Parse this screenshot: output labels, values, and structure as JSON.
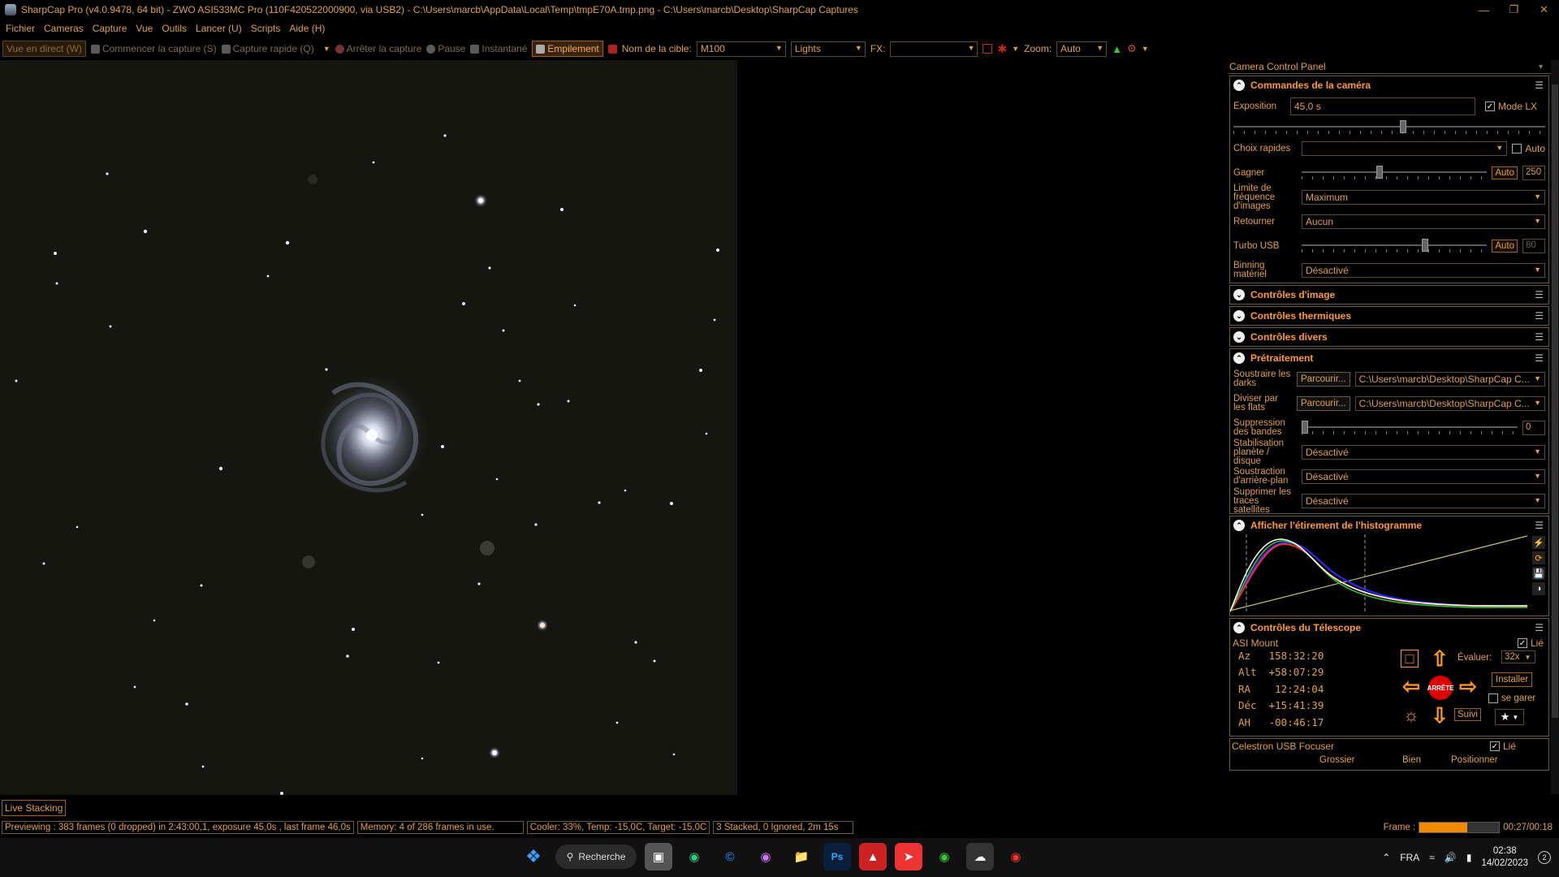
{
  "window": {
    "title": "SharpCap Pro (v4.0.9478, 64 bit) - ZWO ASI533MC Pro (110F420522000900, via USB2) - C:\\Users\\marcb\\AppData\\Local\\Temp\\tmpE70A.tmp.png - C:\\Users\\marcb\\Desktop\\SharpCap Captures"
  },
  "menu": [
    "Fichier",
    "Cameras",
    "Capture",
    "Vue",
    "Outils",
    "Lancer (U)",
    "Scripts",
    "Aide (H)"
  ],
  "toolbar": {
    "live": "Vue en direct (W)",
    "start": "Commencer la capture (S)",
    "quick": "Capture rapide (Q)",
    "stop": "Arrêter la capture",
    "pause": "Pause",
    "snapshot": "Instantané",
    "stack": "Empilement",
    "target_label": "Nom de la cible:",
    "target_value": "M100",
    "frame_type": "Lights",
    "fx_label": "FX:",
    "fx_value": "",
    "zoom_label": "Zoom:",
    "zoom_value": "Auto"
  },
  "viewer": {
    "live_stacking": "Live Stacking"
  },
  "status": {
    "preview": "Previewing : 383 frames (0 dropped) in 2:43:00,1, exposure 45,0s , last frame 46,0s",
    "memory": "Memory: 4 of 286 frames in use.",
    "cooler": "Cooler: 33%, Temp: -15,0C, Target: -15,0C",
    "stacked": "3 Stacked, 0 Ignored, 2m 15s",
    "frame_label": "Frame :",
    "frame_time": "00:27/00:18",
    "frame_progress": 0.6
  },
  "panel": {
    "title": "Camera Control Panel",
    "camera": {
      "header": "Commandes de la caméra",
      "exposure_label": "Exposition",
      "exposure_value": "45,0 s",
      "lx_label": "Mode LX",
      "quick_label": "Choix rapides",
      "auto_label": "Auto",
      "gain_label": "Gagner",
      "gain_auto": "Auto",
      "gain_value": "250",
      "fps_label": "Limite de fréquence d'images",
      "fps_value": "Maximum",
      "flip_label": "Retourner",
      "flip_value": "Aucun",
      "turbo_label": "Turbo USB",
      "turbo_auto": "Auto",
      "turbo_value": "80",
      "binning_label": "Binning matériel",
      "binning_value": "Désactivé"
    },
    "collapsed": [
      "Contrôles d'image",
      "Contrôles thermiques",
      "Contrôles divers"
    ],
    "preproc": {
      "header": "Prétraitement",
      "darks_label": "Soustraire les darks",
      "flats_label": "Diviser par les flats",
      "browse": "Parcourir...",
      "darks_path": "C:\\Users\\marcb\\Desktop\\SharpCap C...",
      "flats_path": "C:\\Users\\marcb\\Desktop\\SharpCap C...",
      "banding_label": "Suppression des bandes",
      "banding_value": "0",
      "stab_label": "Stabilisation planète / disque",
      "stab_value": "Désactivé",
      "bg_label": "Soustraction d'arrière-plan",
      "bg_value": "Désactivé",
      "sat_label": "Supprimer les traces satellites",
      "sat_value": "Désactivé"
    },
    "histogram": {
      "header": "Afficher l'étirement de l'histogramme"
    },
    "telescope": {
      "header": "Contrôles du Télescope",
      "mount": "ASI Mount",
      "linked": "Lié",
      "az": "Az   158:32:20",
      "alt": "Alt  +58:07:29",
      "ra": "RA    12:24:04",
      "dec": "Déc  +15:41:39",
      "ah": "AH   -00:46:17",
      "rate_label": "Évaluer:",
      "rate_value": "32x",
      "install": "Installer",
      "park": "se garer",
      "track": "Suivi",
      "stop": "ARRÊTE"
    },
    "focuser": {
      "name": "Celestron USB Focuser",
      "linked": "Lié",
      "coarse": "Grossier",
      "fine": "Bien",
      "position": "Positionner"
    }
  },
  "taskbar": {
    "search": "Recherche",
    "lang": "FRA",
    "time": "02:38",
    "date": "14/02/2023",
    "badge": "2"
  }
}
